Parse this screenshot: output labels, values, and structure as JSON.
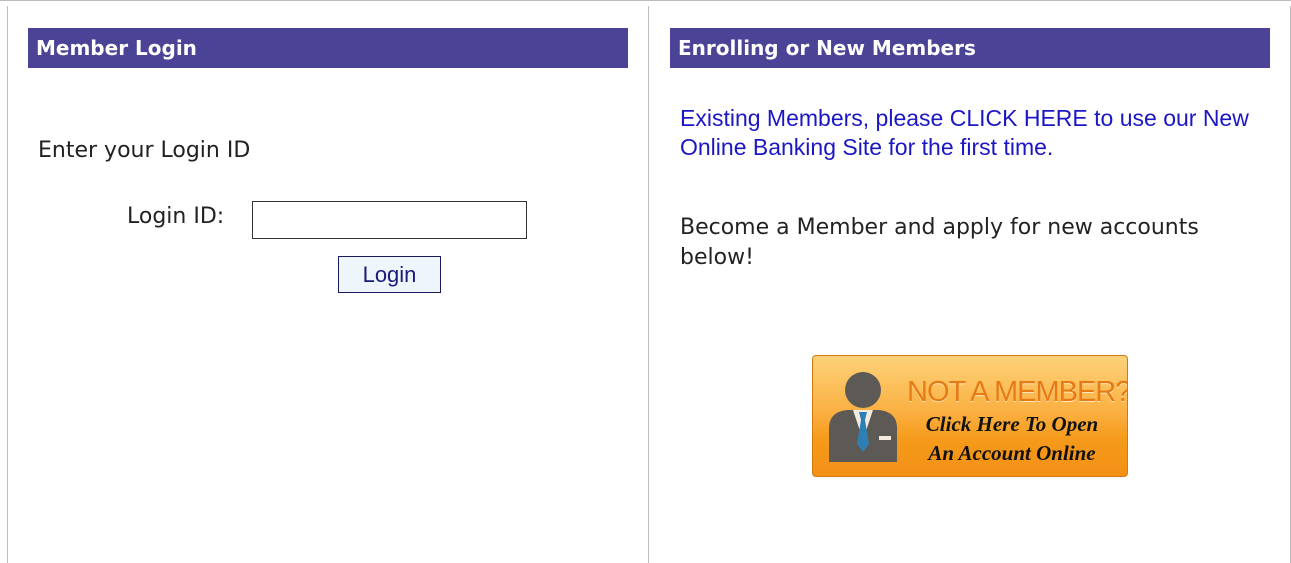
{
  "left_panel": {
    "header": "Member Login",
    "intro": "Enter your Login ID",
    "login_label": "Login ID:",
    "login_value": "",
    "login_button": "Login"
  },
  "right_panel": {
    "header": "Enrolling or New Members",
    "existing_link": "Existing Members, please CLICK HERE to use our New Online Banking Site for the first time.",
    "become_text": "Become a Member and apply for new accounts below!",
    "promo": {
      "title": "NOT A MEMBER?",
      "line1": "Click Here To Open",
      "line2": "An Account Online",
      "icon": "person-icon"
    }
  },
  "colors": {
    "header_bg": "#4a4396",
    "link": "#1c17c4",
    "promo_orange": "#f59a1a"
  }
}
